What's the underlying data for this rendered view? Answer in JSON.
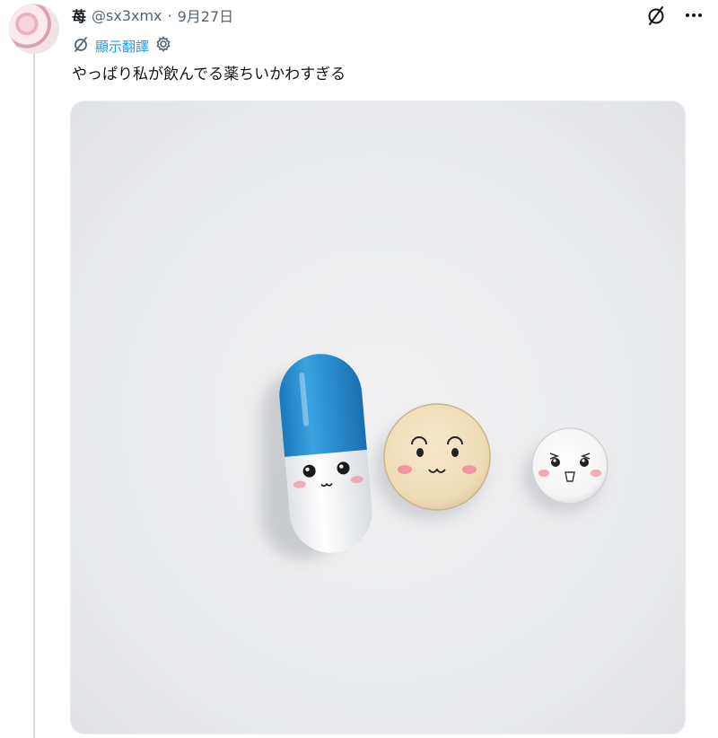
{
  "tweet": {
    "display_name": "苺",
    "handle": "@sx3xmx",
    "separator": "·",
    "date": "9月27日",
    "translate_label": "顯示翻譯",
    "text": "やっぱり私が飲んでる薬ちいかわすぎる"
  },
  "icons": {
    "mute": "slash-circle-icon",
    "more": "more-dots-icon",
    "translate": "slash-circle-icon",
    "settings": "gear-icon"
  },
  "colors": {
    "link": "#1d9bf0",
    "muted": "#536471",
    "text": "#0f1419",
    "capsule_blue": "#2a8fd1"
  }
}
